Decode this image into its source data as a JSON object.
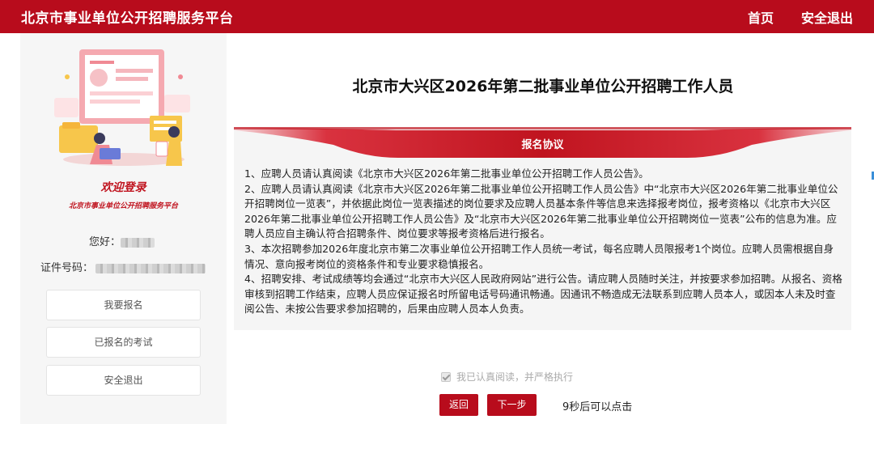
{
  "header": {
    "site_title": "北京市事业单位公开招聘服务平台",
    "nav": {
      "home": "首页",
      "logout": "安全退出"
    }
  },
  "sidebar": {
    "welcome": "欢迎登录",
    "welcome_sub": "北京市事业单位公开招聘服务平台",
    "greeting_label": "您好：",
    "id_label": "证件号码：",
    "buttons": {
      "apply": "我要报名",
      "registered": "已报名的考试",
      "logout": "安全退出"
    }
  },
  "main": {
    "title": "北京市大兴区2026年第二批事业单位公开招聘工作人员",
    "agreement": {
      "heading": "报名协议",
      "paragraphs": [
        "1、应聘人员请认真阅读《北京市大兴区2026年第二批事业单位公开招聘工作人员公告》。",
        "2、应聘人员请认真阅读《北京市大兴区2026年第二批事业单位公开招聘工作人员公告》中“北京市大兴区2026年第二批事业单位公开招聘岗位一览表”，并依据此岗位一览表描述的岗位要求及应聘人员基本条件等信息来选择报考岗位，报考资格以《北京市大兴区2026年第二批事业单位公开招聘工作人员公告》及“北京市大兴区2026年第二批事业单位公开招聘岗位一览表”公布的信息为准。应聘人员应自主确认符合招聘条件、岗位要求等报考资格后进行报名。",
        "3、本次招聘参加2026年度北京市第二次事业单位公开招聘工作人员统一考试，每名应聘人员限报考1个岗位。应聘人员需根据自身情况、意向报考岗位的资格条件和专业要求稳慎报名。",
        "4、招聘安排、考试成绩等均会通过“北京市大兴区人民政府网站”进行公告。请应聘人员随时关注，并按要求参加招聘。从报名、资格审核到招聘工作结束，应聘人员应保证报名时所留电话号码通讯畅通。因通讯不畅造成无法联系到应聘人员本人，或因本人未及时查阅公告、未按公告要求参加招聘的，后果由应聘人员本人负责。"
      ]
    },
    "confirm_label": "我已认真阅读，并严格执行",
    "confirm_checked": true,
    "buttons": {
      "back": "返回",
      "next": "下一步"
    },
    "countdown": "9秒后可以点击"
  },
  "colors": {
    "brand_red": "#b80c1c",
    "panel_gray": "#f6f6f6"
  },
  "icons": [
    "checkbox-icon",
    "recruitment-illustration"
  ]
}
